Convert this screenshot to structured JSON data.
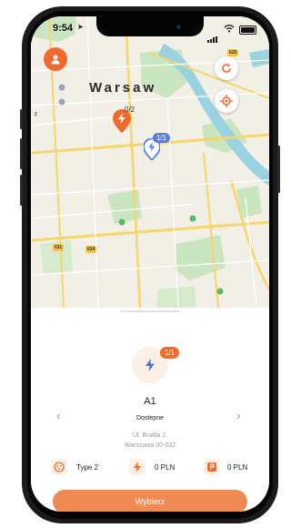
{
  "status_bar": {
    "time": "9:54"
  },
  "map": {
    "city_label": "Warsaw",
    "markers": [
      {
        "count": "0/2",
        "color": "#ef6a2e"
      },
      {
        "count": "1/1",
        "color": "#5a7fd6"
      }
    ],
    "road_numbers": [
      "631",
      "634",
      "629",
      "2"
    ]
  },
  "station": {
    "availability": "1/1",
    "name": "A1",
    "status": "Dostepne",
    "address_line1": "Ul. Brokla 2,",
    "address_line2": "Warszawa 00-032",
    "specs": {
      "connector": "Type 2",
      "charging_price": "0 PLN",
      "parking_price": "0 PLN"
    },
    "select_label": "Wybierz"
  },
  "colors": {
    "accent": "#ef6a2e",
    "button": "#f08a54",
    "map_background": "#f2efe6",
    "water": "#9bd2e2",
    "park": "#c9e6c1",
    "road": "#f6d56b"
  }
}
